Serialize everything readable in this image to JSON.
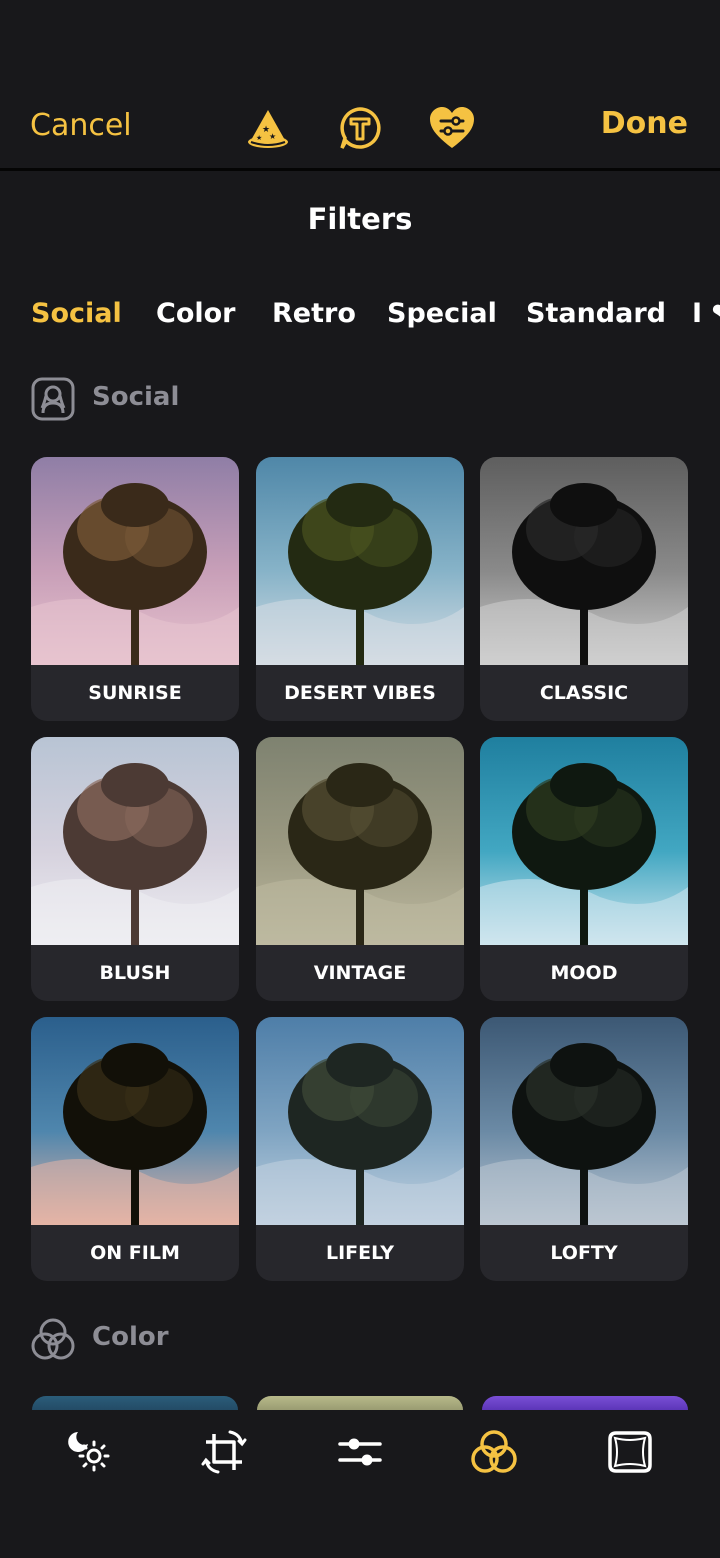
{
  "header": {
    "cancel_label": "Cancel",
    "done_label": "Done",
    "accent_color": "#f5c242"
  },
  "top_icons": [
    "wizard-hat-icon",
    "text-bubble-icon",
    "heart-adjust-icon"
  ],
  "title": "Filters",
  "tabs": [
    {
      "label": "Social",
      "active": true
    },
    {
      "label": "Color",
      "active": false
    },
    {
      "label": "Retro",
      "active": false
    },
    {
      "label": "Special",
      "active": false
    },
    {
      "label": "Standard",
      "active": false
    },
    {
      "label": "I ❤",
      "active": false
    }
  ],
  "sections": [
    {
      "label": "Social",
      "icon": "portrait-frame-icon",
      "filters": [
        {
          "label": "SUNRISE"
        },
        {
          "label": "DESERT VIBES"
        },
        {
          "label": "CLASSIC"
        },
        {
          "label": "BLUSH"
        },
        {
          "label": "VINTAGE"
        },
        {
          "label": "MOOD"
        },
        {
          "label": "ON FILM"
        },
        {
          "label": "LIFELY"
        },
        {
          "label": "LOFTY"
        }
      ]
    },
    {
      "label": "Color",
      "icon": "three-circles-icon"
    }
  ],
  "bottom_nav": [
    {
      "icon": "auto-enhance-icon",
      "active": false
    },
    {
      "icon": "crop-rotate-icon",
      "active": false
    },
    {
      "icon": "adjust-sliders-icon",
      "active": false
    },
    {
      "icon": "filters-icon",
      "active": true
    },
    {
      "icon": "frame-icon",
      "active": false
    }
  ]
}
